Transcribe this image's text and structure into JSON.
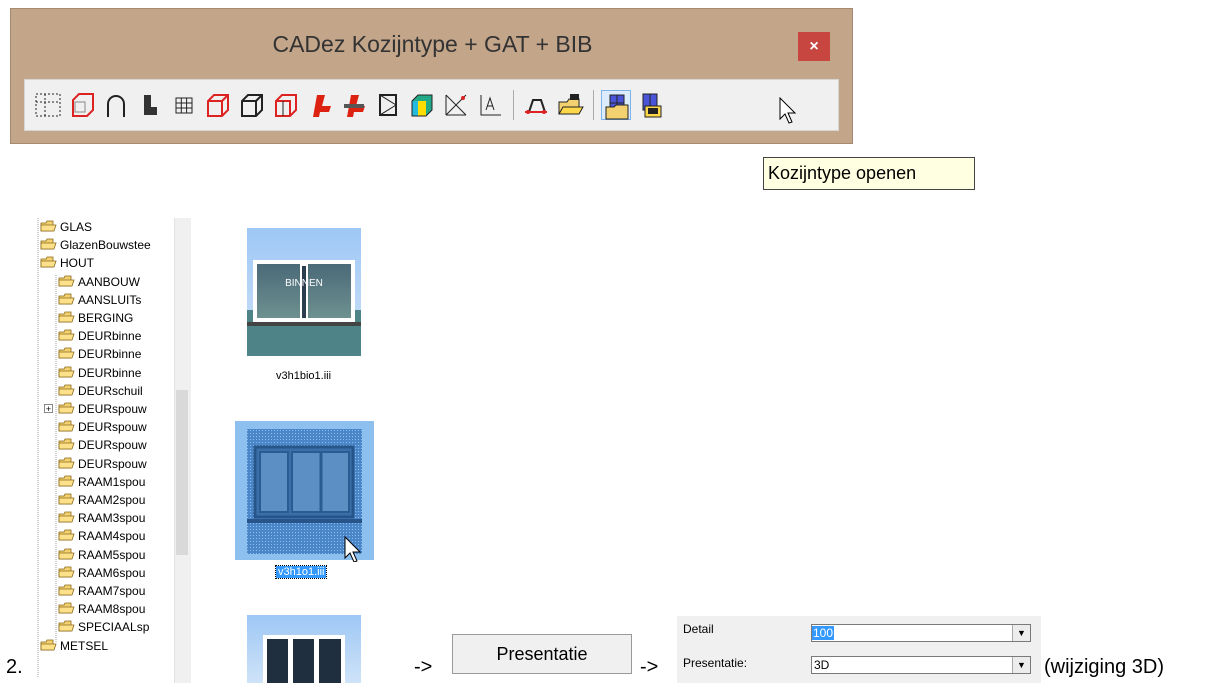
{
  "window": {
    "title": "CADez Kozijntype + GAT + BIB",
    "close_label": "×"
  },
  "tooltip": {
    "text": "Kozijntype openen"
  },
  "tree": {
    "items": [
      {
        "label": "GLAS",
        "level": 0
      },
      {
        "label": "GlazenBouwstee",
        "level": 0
      },
      {
        "label": "HOUT",
        "level": 0
      },
      {
        "label": "AANBOUW",
        "level": 1
      },
      {
        "label": "AANSLUITs",
        "level": 1
      },
      {
        "label": "BERGING",
        "level": 1
      },
      {
        "label": "DEURbinne",
        "level": 1
      },
      {
        "label": "DEURbinne",
        "level": 1
      },
      {
        "label": "DEURbinne",
        "level": 1
      },
      {
        "label": "DEURschuil",
        "level": 1
      },
      {
        "label": "DEURspouw",
        "level": 1,
        "expandable": true
      },
      {
        "label": "DEURspouw",
        "level": 1
      },
      {
        "label": "DEURspouw",
        "level": 1
      },
      {
        "label": "DEURspouw",
        "level": 1
      },
      {
        "label": "RAAM1spou",
        "level": 1
      },
      {
        "label": "RAAM2spou",
        "level": 1
      },
      {
        "label": "RAAM3spou",
        "level": 1
      },
      {
        "label": "RAAM4spou",
        "level": 1
      },
      {
        "label": "RAAM5spou",
        "level": 1
      },
      {
        "label": "RAAM6spou",
        "level": 1
      },
      {
        "label": "RAAM7spou",
        "level": 1
      },
      {
        "label": "RAAM8spou",
        "level": 1
      },
      {
        "label": "SPECIAALsp",
        "level": 1
      },
      {
        "label": "METSEL",
        "level": 0
      }
    ]
  },
  "thumbnails": [
    {
      "label": "v3h1bio1.iii",
      "overlay_text": "BINNEN"
    },
    {
      "label": "v3h1o1.iii"
    }
  ],
  "step": {
    "number": "2.",
    "arrow1": "->",
    "arrow2": "->",
    "note": "(wijziging 3D)"
  },
  "presentatie_button": {
    "label": "Presentatie"
  },
  "detail_panel": {
    "detail_label": "Detail",
    "detail_value": "100",
    "presentatie_label": "Presentatie:",
    "presentatie_value": "3D",
    "dropdown_glyph": "▼"
  },
  "colors": {
    "folder": "#f3d070",
    "accent": "#3399ff",
    "title_bar": "#c3a58a",
    "close": "#c7463f"
  }
}
